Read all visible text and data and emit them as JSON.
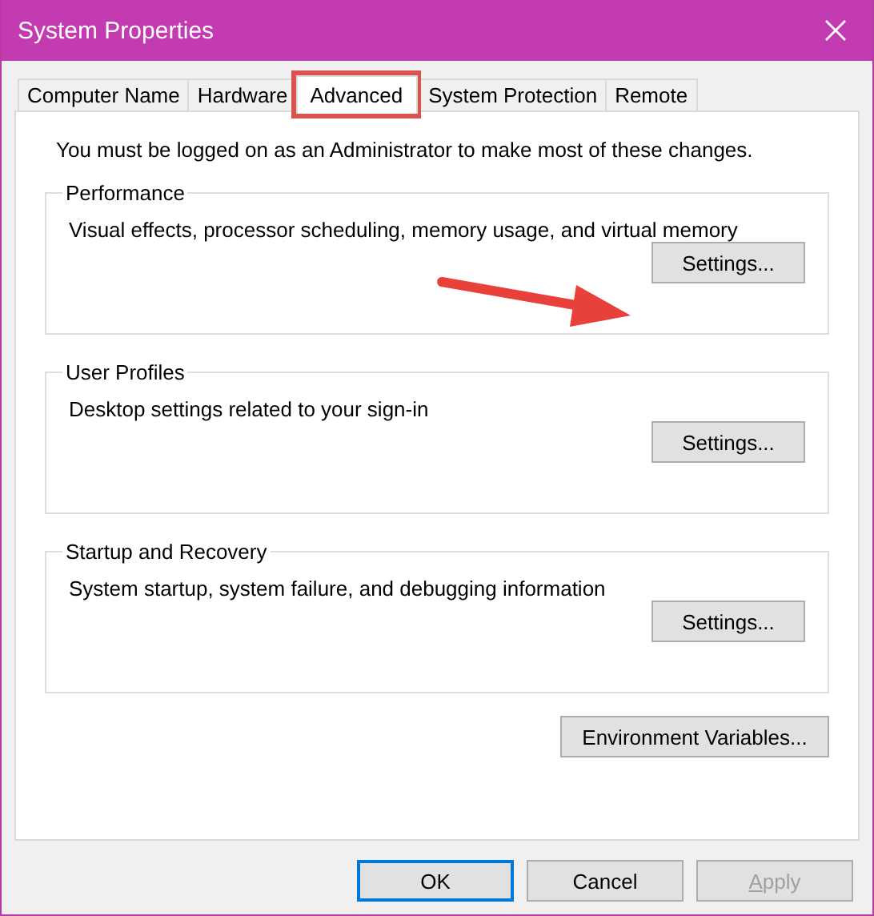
{
  "window": {
    "title": "System Properties"
  },
  "tabs": [
    {
      "label": "Computer Name",
      "selected": false
    },
    {
      "label": "Hardware",
      "selected": false
    },
    {
      "label": "Advanced",
      "selected": true
    },
    {
      "label": "System Protection",
      "selected": false
    },
    {
      "label": "Remote",
      "selected": false
    }
  ],
  "notice": "You must be logged on as an Administrator to make most of these changes.",
  "groups": [
    {
      "title": "Performance",
      "description": "Visual effects, processor scheduling, memory usage, and virtual memory",
      "button": "Settings..."
    },
    {
      "title": "User Profiles",
      "description": "Desktop settings related to your sign-in",
      "button": "Settings..."
    },
    {
      "title": "Startup and Recovery",
      "description": "System startup, system failure, and debugging information",
      "button": "Settings..."
    }
  ],
  "environment_button": "Environment Variables...",
  "buttons": [
    {
      "label": "OK",
      "default": true,
      "disabled": false,
      "underline_first": false
    },
    {
      "label": "Cancel",
      "default": false,
      "disabled": false,
      "underline_first": false
    },
    {
      "label": "Apply",
      "default": false,
      "disabled": true,
      "underline_first": true
    }
  ]
}
